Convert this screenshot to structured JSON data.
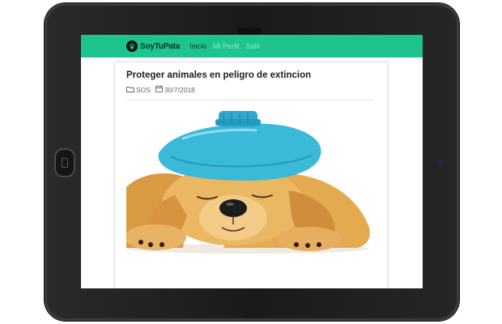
{
  "brand": {
    "name": "SoyTuPata",
    "logo_icon": "paw-icon",
    "color": "#1ec48e"
  },
  "nav": {
    "links": [
      {
        "label": "Inicio"
      },
      {
        "label": "Mi Perfil"
      },
      {
        "label": "Salir"
      }
    ]
  },
  "post": {
    "title": "Proteger animales en peligro de extincion",
    "category_icon": "folder-icon",
    "category": "SOS",
    "date_icon": "calendar-icon",
    "date": "30/7/2018"
  }
}
